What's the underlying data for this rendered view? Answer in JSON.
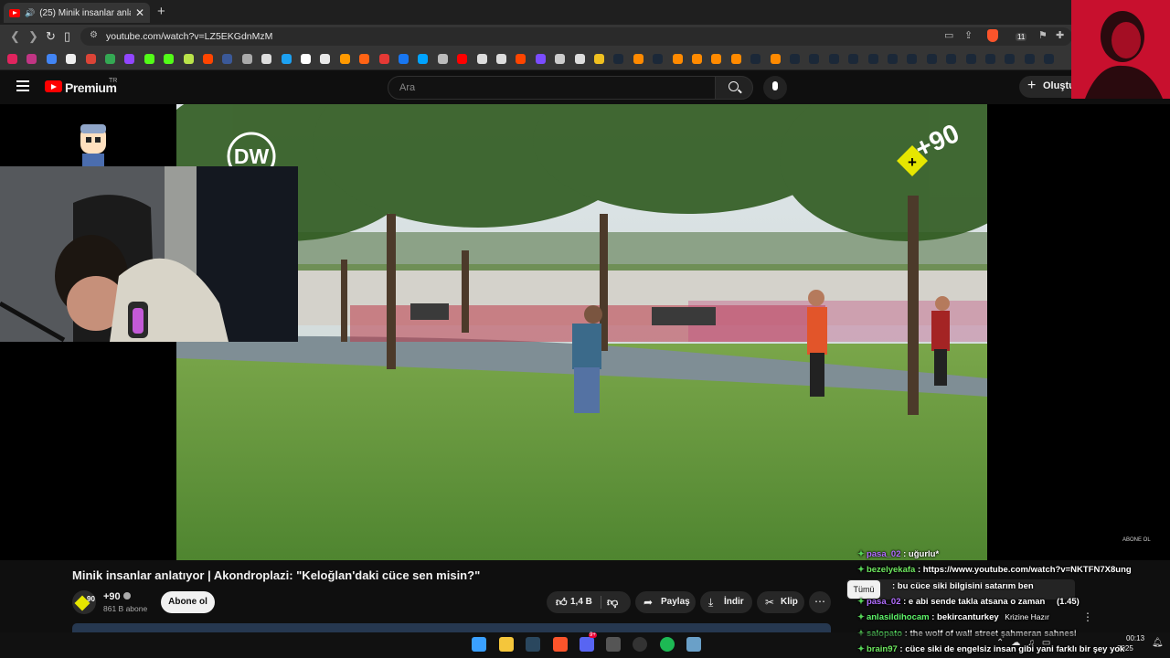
{
  "browser": {
    "tab_title": "(25) Minik insanlar anlatıyor |",
    "tab_close": "✕",
    "new_tab": "+",
    "url": "youtube.com/watch?v=LZ5EKGdnMzM",
    "shields_count": "11"
  },
  "youtube": {
    "logo_text": "Premium",
    "country": "TR",
    "search_placeholder": "Ara",
    "create_label": "Oluştur"
  },
  "video": {
    "logo_text": "DW",
    "channel_badge": "+90",
    "watermark": "ABONE OL",
    "title": "Minik insanlar anlatıyor | Akondroplazi: \"Keloğlan'daki cüce sen misin?\"",
    "channel_name": "+90",
    "subscribers": "861 B abone",
    "subscribe_label": "Abone ol",
    "likes": "1,4 B",
    "share_label": "Paylaş",
    "download_label": "İndir",
    "clip_label": "Klip",
    "more_label": "⋯"
  },
  "chat": {
    "tab_all": "Tümü",
    "messages": [
      {
        "user": "pasa_02",
        "text": ": uğurlu*"
      },
      {
        "user": "bezelyekafa",
        "text": ": https://www.youtube.com/watch?v=NKTFN7X8ung"
      },
      {
        "user": "",
        "text": ": bu cüce siki bilgisini satarım ben"
      },
      {
        "user": "pasa_02",
        "text": ": e abi sende takla atsana o zaman"
      },
      {
        "user": "anlasildihocam",
        "text": ": bekircanturkey"
      },
      {
        "user": "salopato",
        "text": ": the wolf of wall street şahmeran sahnesi"
      },
      {
        "user": "brain97",
        "text": ": cüce siki de engelsiz insan gibi yani farklı bir şey yok"
      }
    ],
    "donation": "(1.45)",
    "side_note": "Krizine Hazır"
  },
  "taskbar": {
    "time": "00:13",
    "date": "2025",
    "discord_badge": "9+"
  }
}
